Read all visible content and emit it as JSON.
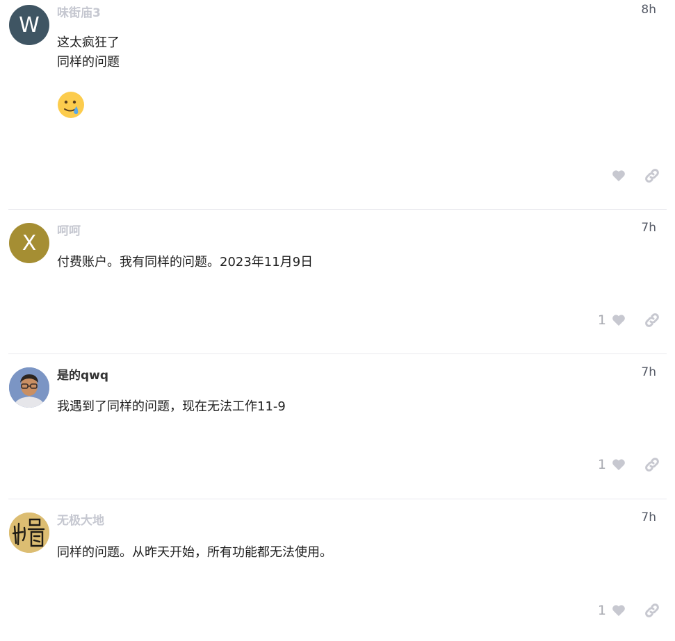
{
  "posts": [
    {
      "avatar_letter": "W",
      "avatar_color": "#3f5563",
      "username": "味街庙3",
      "time": "8h",
      "lines": [
        "这太疯狂了",
        "同样的问题"
      ],
      "emoji": "crying-face-icon",
      "likes": ""
    },
    {
      "avatar_letter": "X",
      "avatar_color": "#a58e33",
      "username": "呵呵",
      "time": "7h",
      "lines": [
        "付费账户。我有同样的问题。2023年11月9日"
      ],
      "likes": "1"
    },
    {
      "avatar_letter": "",
      "avatar_color": "#6c86b8",
      "username": "是的qwq",
      "time": "7h",
      "lines": [
        "我遇到了同样的问题，现在无法工作11-9"
      ],
      "likes": "1"
    },
    {
      "avatar_letter": "",
      "avatar_color": "#d7b86a",
      "username": "无极大地",
      "time": "7h",
      "lines": [
        "同样的问题。从昨天开始，所有功能都无法使用。"
      ],
      "likes": "1"
    }
  ],
  "colors": {
    "muted_username": "#c5c7d0",
    "icon_gray": "#c7c8d0",
    "divider": "#e9e9ee"
  }
}
